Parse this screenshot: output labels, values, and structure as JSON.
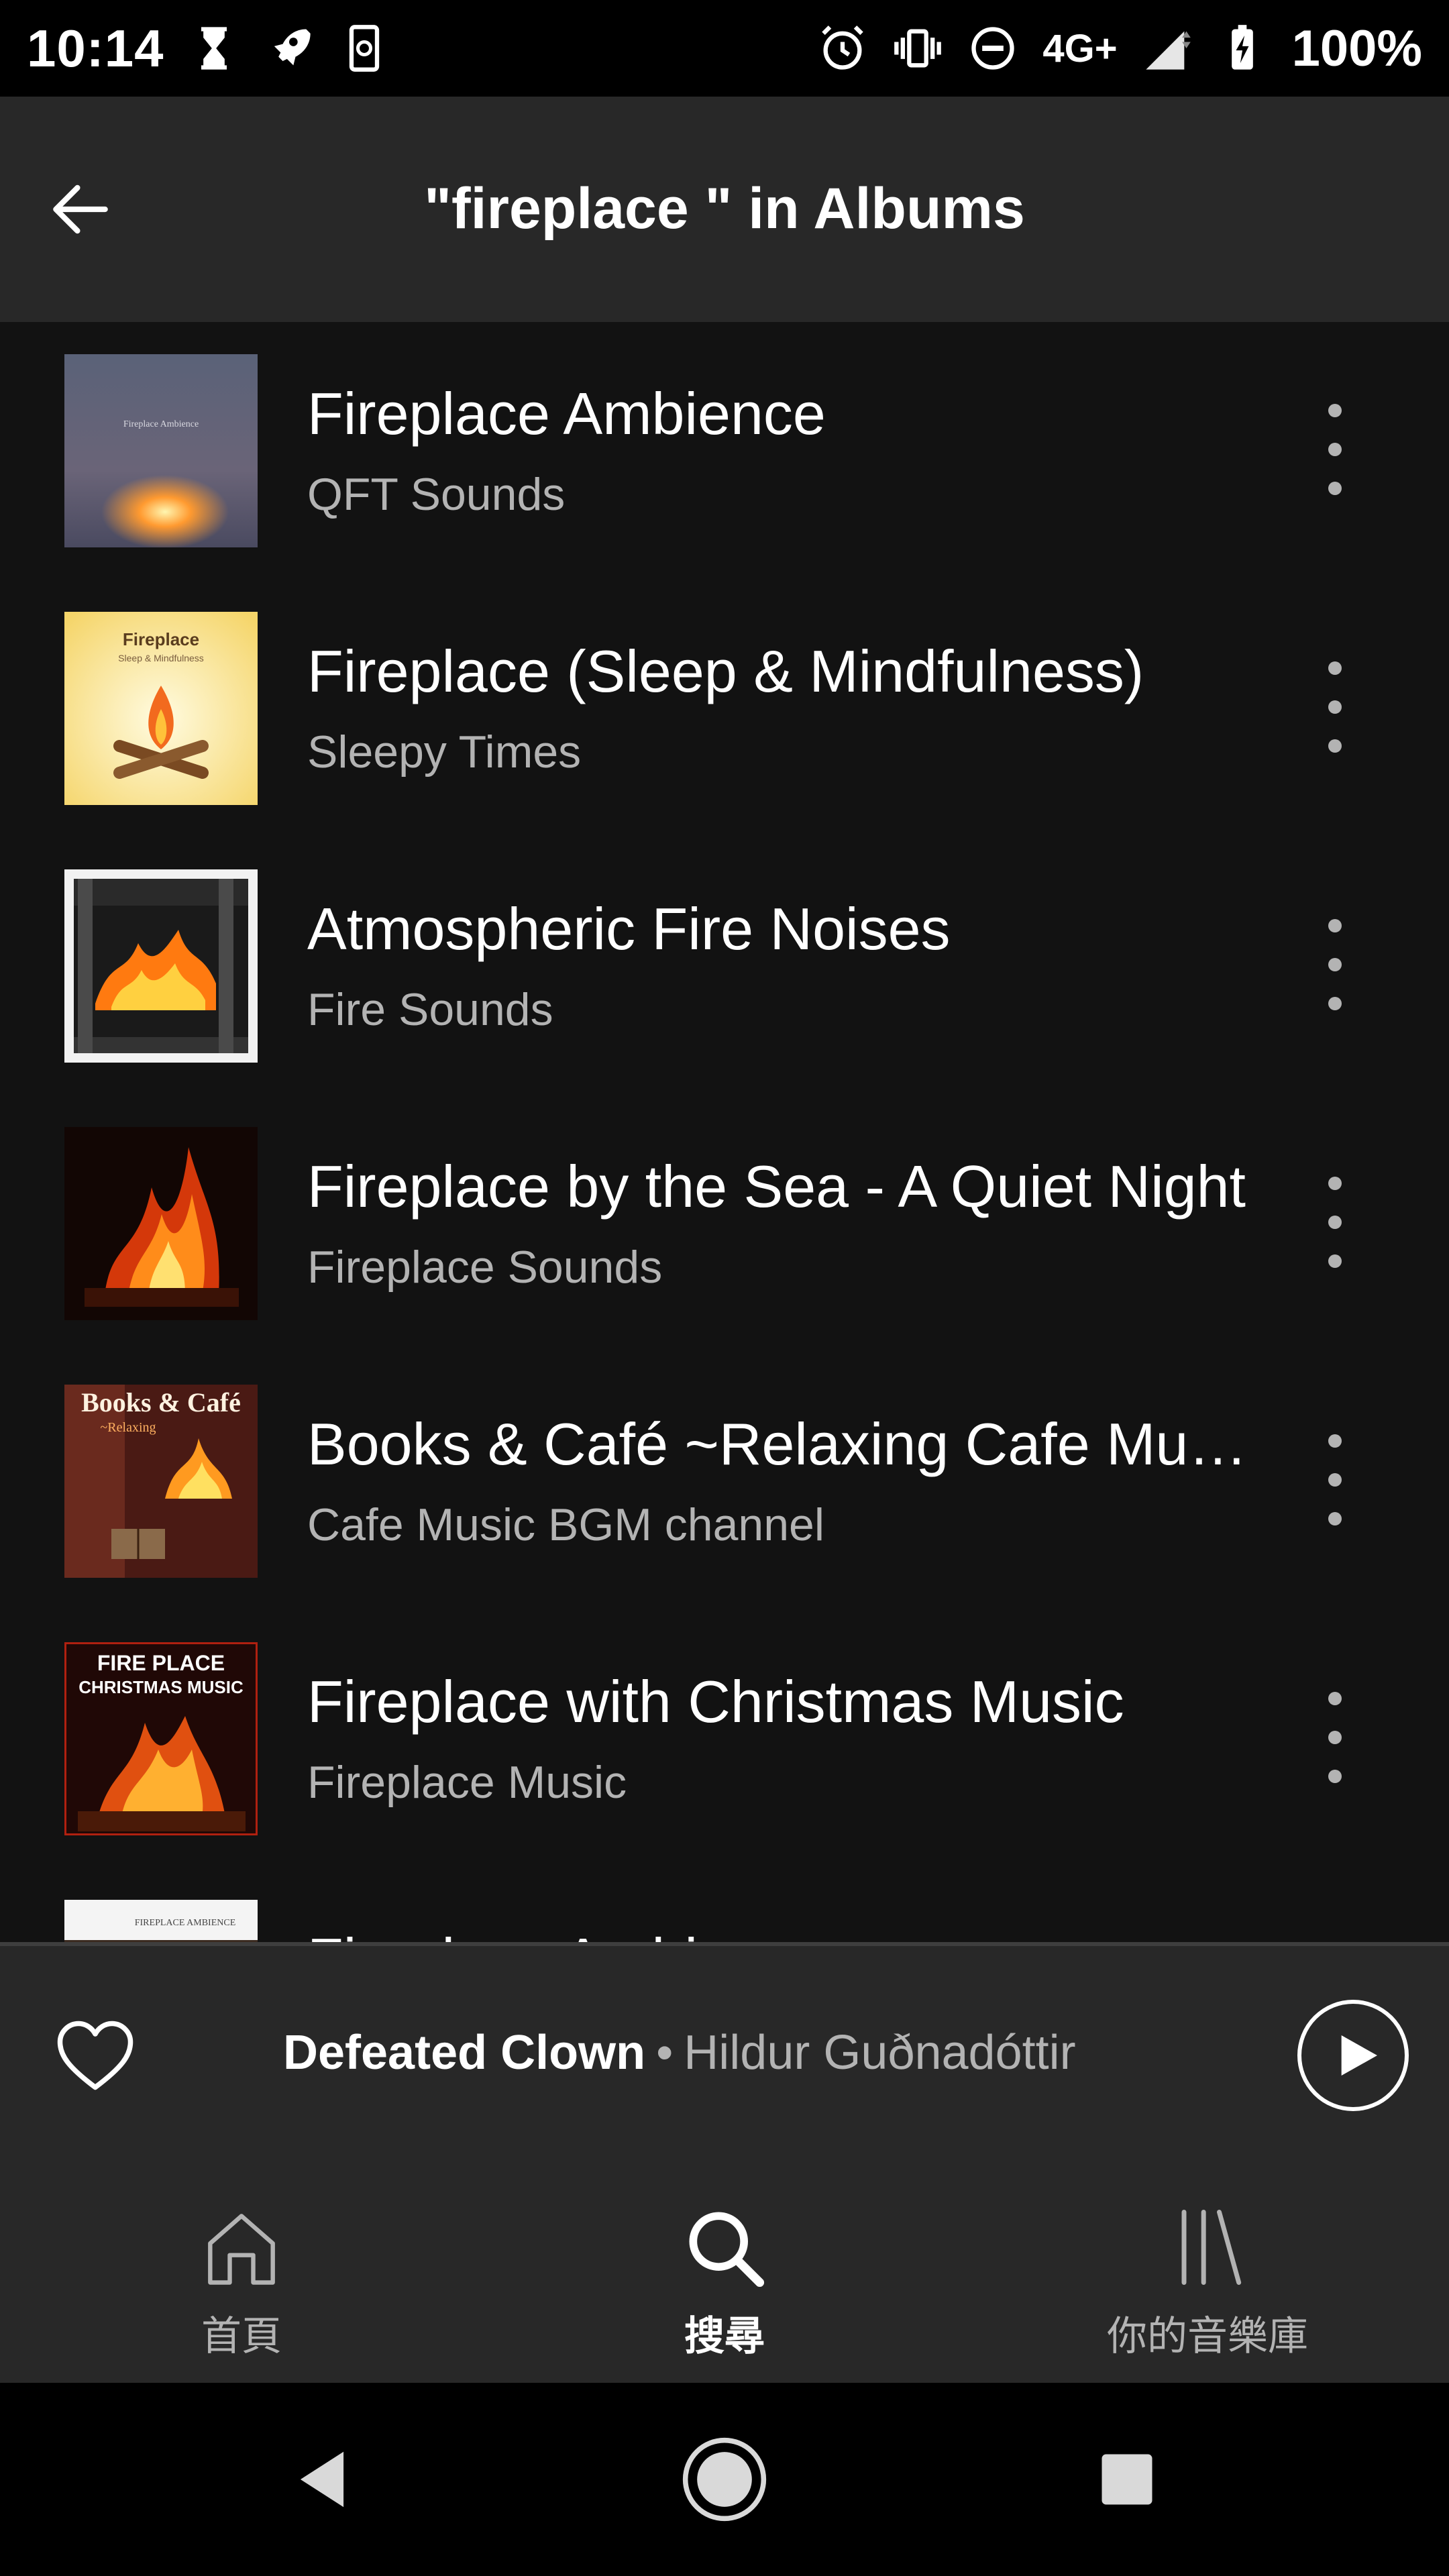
{
  "status_bar": {
    "time": "10:14",
    "network": "4G+",
    "battery": "100%"
  },
  "header": {
    "title": "\"fireplace \" in Albums"
  },
  "results": [
    {
      "title": "Fireplace Ambience",
      "artist": "QFT Sounds",
      "cover_text": "Fireplace Ambience"
    },
    {
      "title": "Fireplace (Sleep & Mindfulness)",
      "artist": "Sleepy Times",
      "cover_text": "Fireplace",
      "cover_subtext": "Sleep & Mindfulness"
    },
    {
      "title": "Atmospheric Fire Noises",
      "artist": "Fire Sounds"
    },
    {
      "title": "Fireplace by the Sea - A Quiet Night",
      "artist": "Fireplace Sounds"
    },
    {
      "title": "Books & Café ~Relaxing Cafe Music",
      "artist": "Cafe Music BGM channel",
      "cover_text": "Books & Café",
      "cover_subtext": "~Relaxing"
    },
    {
      "title": "Fireplace with Christmas Music",
      "artist": "Fireplace Music",
      "cover_text": "FIRE PLACE",
      "cover_subtext": "CHRISTMAS MUSIC"
    },
    {
      "title": "Fireplace Ambience",
      "artist": "",
      "cover_text": "FIREPLACE AMBIENCE"
    }
  ],
  "now_playing": {
    "track": "Defeated Clown",
    "separator": "•",
    "artist": "Hildur Guðnadóttir"
  },
  "bottom_nav": {
    "home": "首頁",
    "search": "搜尋",
    "library": "你的音樂庫"
  },
  "colors": {
    "background": "#121212",
    "surface": "#282828",
    "secondary_text": "#b3b3b3"
  }
}
